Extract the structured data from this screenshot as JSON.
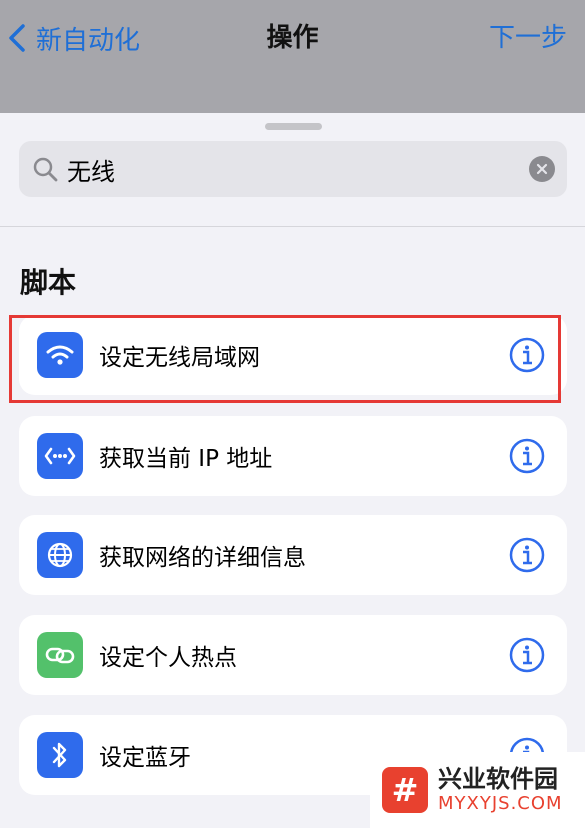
{
  "nav": {
    "back_label": "新自动化",
    "title": "操作",
    "next_label": "下一步"
  },
  "search": {
    "query": "无线"
  },
  "section": {
    "title": "脚本"
  },
  "actions": [
    {
      "label": "设定无线局域网",
      "icon": "wifi-icon",
      "color": "#2f6bec"
    },
    {
      "label": "获取当前 IP 地址",
      "icon": "network-dots-icon",
      "color": "#2f6bec"
    },
    {
      "label": "获取网络的详细信息",
      "icon": "globe-icon",
      "color": "#2f6bec"
    },
    {
      "label": "设定个人热点",
      "icon": "link-icon",
      "color": "#53c16b"
    },
    {
      "label": "设定蓝牙",
      "icon": "bluetooth-icon",
      "color": "#2f6bec"
    }
  ],
  "watermark": {
    "brand": "兴业软件园",
    "domain": "MYXYJS.COM",
    "logo_glyph": "#"
  },
  "colors": {
    "accent": "#1f6fd6",
    "highlight": "#e53935"
  }
}
